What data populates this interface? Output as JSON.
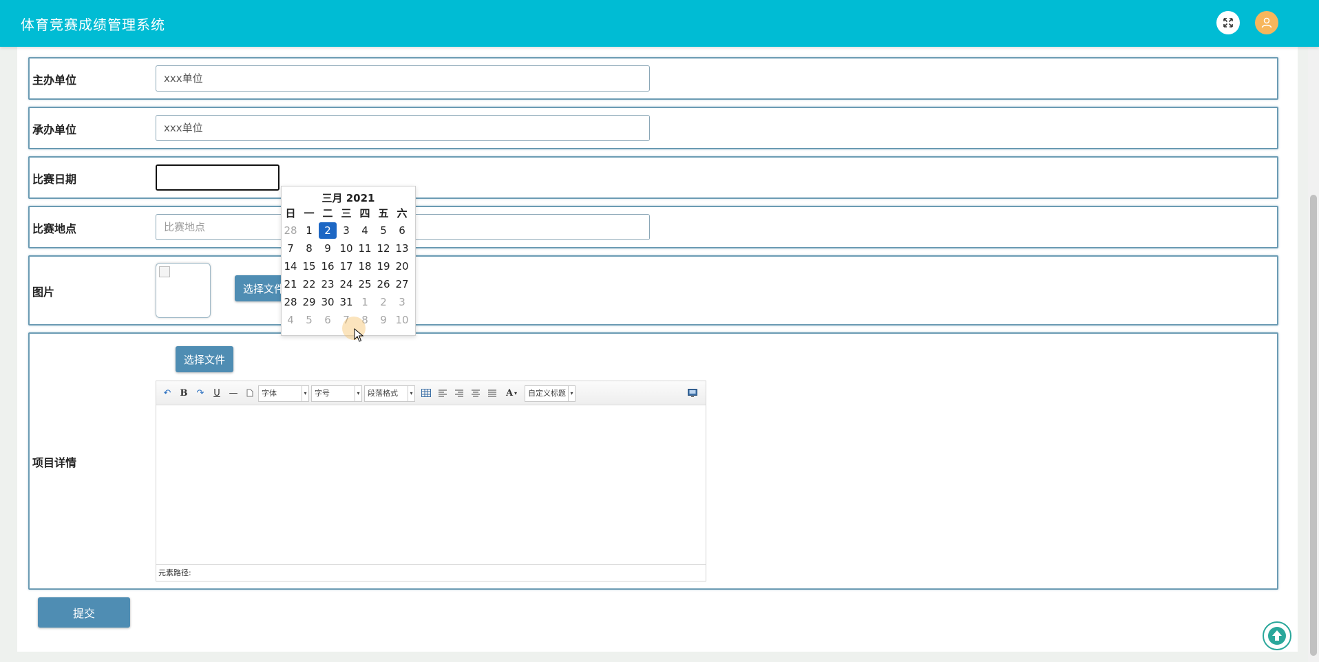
{
  "header": {
    "title": "体育竞赛成绩管理系统",
    "colors": {
      "bar": "#00bcd4",
      "avatar": "#f7b65c"
    },
    "icons": [
      "fullscreen-icon",
      "user-icon"
    ]
  },
  "form": {
    "organizer": {
      "label": "主办单位",
      "value": "xxx单位"
    },
    "co_organizer": {
      "label": "承办单位",
      "value": "xxx单位"
    },
    "match_date": {
      "label": "比赛日期",
      "value": ""
    },
    "location": {
      "label": "比赛地点",
      "placeholder": "比赛地点"
    },
    "image": {
      "label": "图片",
      "button": "选择文件"
    },
    "details": {
      "label": "项目详情",
      "button": "选择文件",
      "editor": {
        "font_family": "字体",
        "font_size": "字号",
        "paragraph": "段落格式",
        "custom_heading": "自定义标题",
        "status_path": "元素路径:",
        "tool_icons": [
          "undo-icon",
          "bold-icon",
          "redo-icon",
          "underline-icon",
          "horizontal-rule-icon",
          "page-icon",
          "table-icon",
          "align-left-icon",
          "align-right-icon",
          "align-center-icon",
          "justify-icon",
          "font-color-icon",
          "fullscreen-editor-icon"
        ]
      }
    },
    "submit": "提交"
  },
  "calendar": {
    "title": "三月 2021",
    "weekdays": [
      "日",
      "一",
      "二",
      "三",
      "四",
      "五",
      "六"
    ],
    "weeks": [
      [
        "28",
        "1",
        "2",
        "3",
        "4",
        "5",
        "6"
      ],
      [
        "7",
        "8",
        "9",
        "10",
        "11",
        "12",
        "13"
      ],
      [
        "14",
        "15",
        "16",
        "17",
        "18",
        "19",
        "20"
      ],
      [
        "21",
        "22",
        "23",
        "24",
        "25",
        "26",
        "27"
      ],
      [
        "28",
        "29",
        "30",
        "31",
        "1",
        "2",
        "3"
      ],
      [
        "4",
        "5",
        "6",
        "7",
        "8",
        "9",
        "10"
      ]
    ],
    "selected": "2",
    "selected_color": "#1d67c4"
  }
}
